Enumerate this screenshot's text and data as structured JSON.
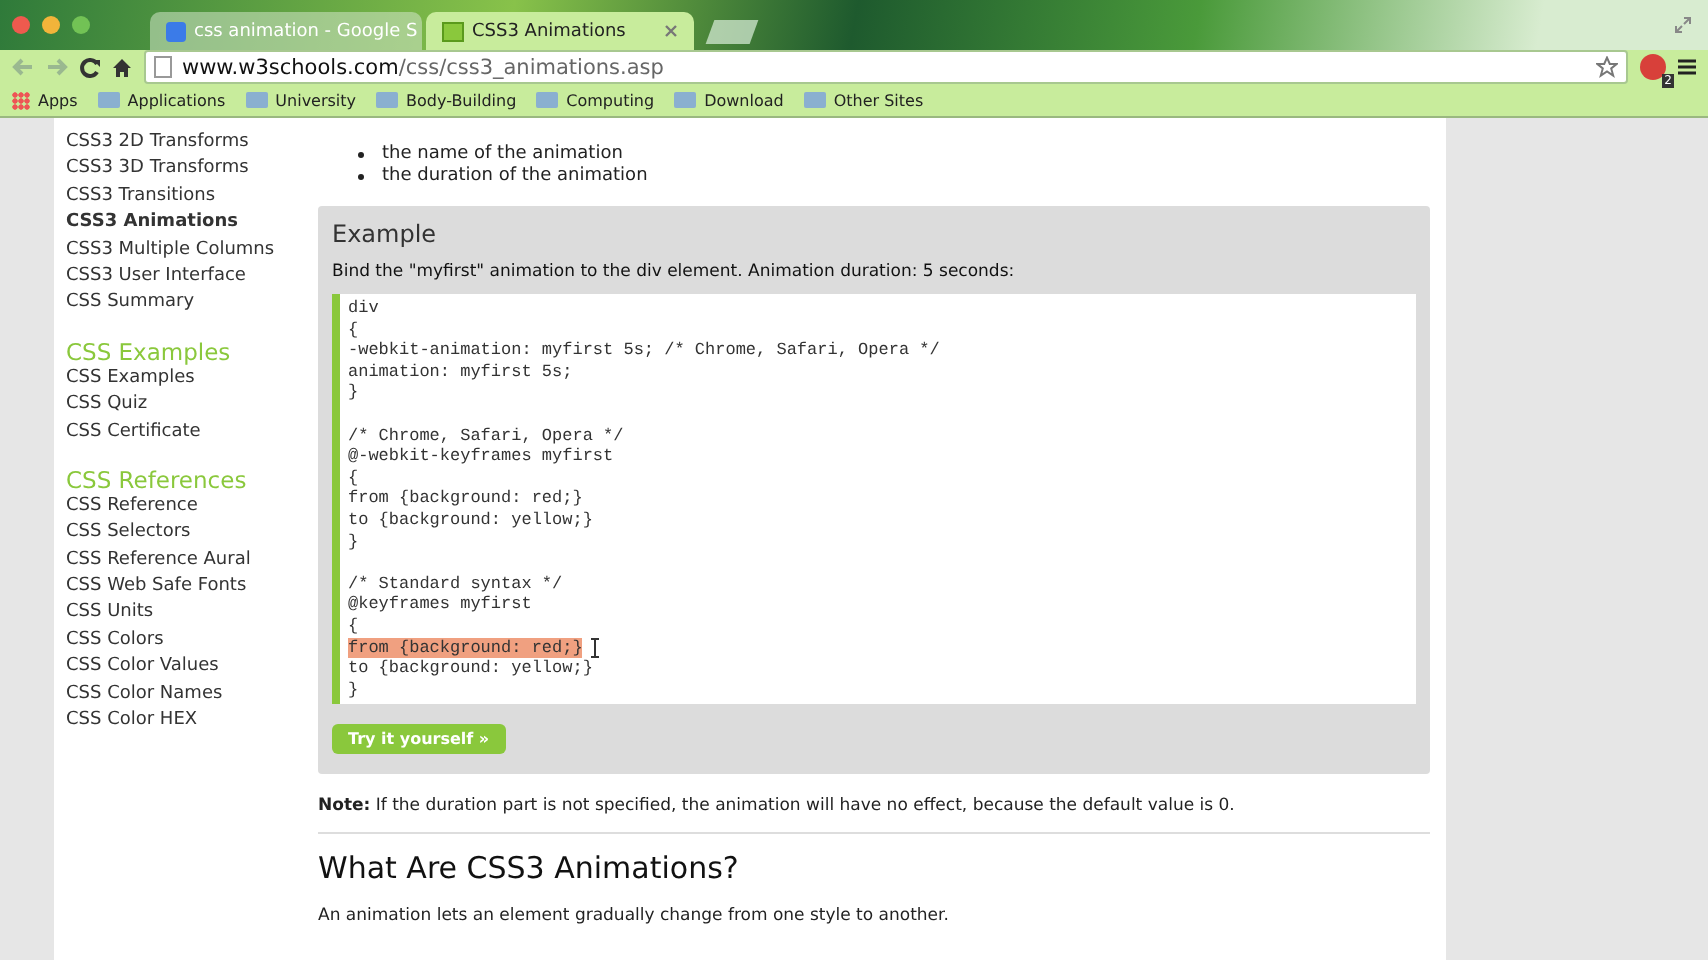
{
  "tabs": [
    {
      "title": "css animation - Google S",
      "selected": false
    },
    {
      "title": "CSS3 Animations",
      "selected": true
    }
  ],
  "address": {
    "host": "www.w3schools.com",
    "path": "/css/css3_animations.asp"
  },
  "extension_badge": "2",
  "bookmarks": [
    {
      "label": "Apps",
      "kind": "apps"
    },
    {
      "label": "Applications",
      "kind": "folder"
    },
    {
      "label": "University",
      "kind": "folder"
    },
    {
      "label": "Body-Building",
      "kind": "folder"
    },
    {
      "label": "Computing",
      "kind": "folder"
    },
    {
      "label": "Download",
      "kind": "folder"
    },
    {
      "label": "Other Sites",
      "kind": "folder"
    }
  ],
  "sidebar": [
    {
      "kind": "link",
      "label": "CSS3 2D Transforms",
      "selected": false
    },
    {
      "kind": "link",
      "label": "CSS3 3D Transforms",
      "selected": false
    },
    {
      "kind": "link",
      "label": "CSS3 Transitions",
      "selected": false
    },
    {
      "kind": "link",
      "label": "CSS3 Animations",
      "selected": true
    },
    {
      "kind": "link",
      "label": "CSS3 Multiple Columns",
      "selected": false
    },
    {
      "kind": "link",
      "label": "CSS3 User Interface",
      "selected": false
    },
    {
      "kind": "link",
      "label": "CSS Summary",
      "selected": false
    },
    {
      "kind": "heading",
      "label": "CSS Examples"
    },
    {
      "kind": "link",
      "label": "CSS Examples",
      "selected": false
    },
    {
      "kind": "link",
      "label": "CSS Quiz",
      "selected": false
    },
    {
      "kind": "link",
      "label": "CSS Certificate",
      "selected": false
    },
    {
      "kind": "heading",
      "label": "CSS References"
    },
    {
      "kind": "link",
      "label": "CSS Reference",
      "selected": false
    },
    {
      "kind": "link",
      "label": "CSS Selectors",
      "selected": false
    },
    {
      "kind": "link",
      "label": "CSS Reference Aural",
      "selected": false
    },
    {
      "kind": "link",
      "label": "CSS Web Safe Fonts",
      "selected": false
    },
    {
      "kind": "link",
      "label": "CSS Units",
      "selected": false
    },
    {
      "kind": "link",
      "label": "CSS Colors",
      "selected": false
    },
    {
      "kind": "link",
      "label": "CSS Color Values",
      "selected": false
    },
    {
      "kind": "link",
      "label": "CSS Color Names",
      "selected": false
    },
    {
      "kind": "link",
      "label": "CSS Color HEX",
      "selected": false
    }
  ],
  "bullets": [
    "the name of the animation",
    "the duration of the animation"
  ],
  "example": {
    "title": "Example",
    "description": "Bind the \"myfirst\" animation to the div element. Animation duration: 5 seconds:",
    "code_blocks": [
      [
        {
          "text": "div",
          "highlighted": false
        },
        {
          "text": "{",
          "highlighted": false
        },
        {
          "text": "-webkit-animation: myfirst 5s; /* Chrome, Safari, Opera */",
          "highlighted": false
        },
        {
          "text": "animation: myfirst 5s;",
          "highlighted": false
        },
        {
          "text": "}",
          "highlighted": false
        }
      ],
      [
        {
          "text": "/* Chrome, Safari, Opera */",
          "highlighted": false
        },
        {
          "text": "@-webkit-keyframes myfirst",
          "highlighted": false
        },
        {
          "text": "{",
          "highlighted": false
        },
        {
          "text": "from {background: red;}",
          "highlighted": false
        },
        {
          "text": "to {background: yellow;}",
          "highlighted": false
        },
        {
          "text": "}",
          "highlighted": false
        }
      ],
      [
        {
          "text": "/* Standard syntax */",
          "highlighted": false
        },
        {
          "text": "@keyframes myfirst",
          "highlighted": false
        },
        {
          "text": "{",
          "highlighted": false
        },
        {
          "text": "from {background: red;}",
          "highlighted": true
        },
        {
          "text": "to {background: yellow;}",
          "highlighted": false
        },
        {
          "text": "}",
          "highlighted": false
        }
      ]
    ],
    "button": "Try it yourself »"
  },
  "note": "**Note:** If the duration part is not specified, the animation will have no effect, because the default value is 0.",
  "heading": "What Are CSS3 Animations?",
  "paragraph": "An animation lets an element gradually change from one style to another."
}
